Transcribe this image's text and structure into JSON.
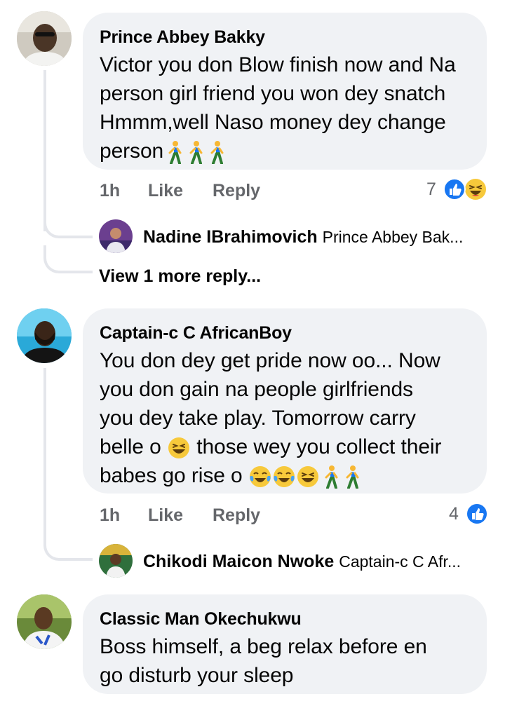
{
  "comments": [
    {
      "author": "Prince Abbey Bakky",
      "text": "Victor you don Blow finish now and Na person girl friend you won dey snatch Hmmm,well Naso money dey change person",
      "time": "1h",
      "like_label": "Like",
      "reply_label": "Reply",
      "reaction_count": "7",
      "reactions": [
        "like-icon",
        "haha-icon"
      ],
      "reply": {
        "author": "Nadine IBrahimovich",
        "preview": "Prince Abbey Bak..."
      },
      "view_more": "View 1 more reply..."
    },
    {
      "author": "Captain-c C AfricanBoy",
      "text_lines": [
        "You don dey get pride now oo... Now",
        "you don gain na people girlfriends",
        "you dey take play. Tomorrow carry"
      ],
      "text_line4_a": "belle o",
      "text_line4_b": "those wey you collect their",
      "text_line5": "babes go rise o",
      "time": "1h",
      "like_label": "Like",
      "reply_label": "Reply",
      "reaction_count": "4",
      "reactions": [
        "like-icon"
      ],
      "reply": {
        "author": "Chikodi Maicon Nwoke",
        "preview": "Captain-c C Afr..."
      }
    },
    {
      "author": "Classic Man Okechukwu",
      "text_lines": [
        "Boss himself, a beg relax before en",
        "go disturb your sleep"
      ]
    }
  ],
  "colors": {
    "bubble": "#f0f2f5",
    "meta_text": "#65676b",
    "thread_line": "#e4e6eb",
    "like_blue": "#1877f2",
    "haha_yellow": "#f7c93b"
  }
}
